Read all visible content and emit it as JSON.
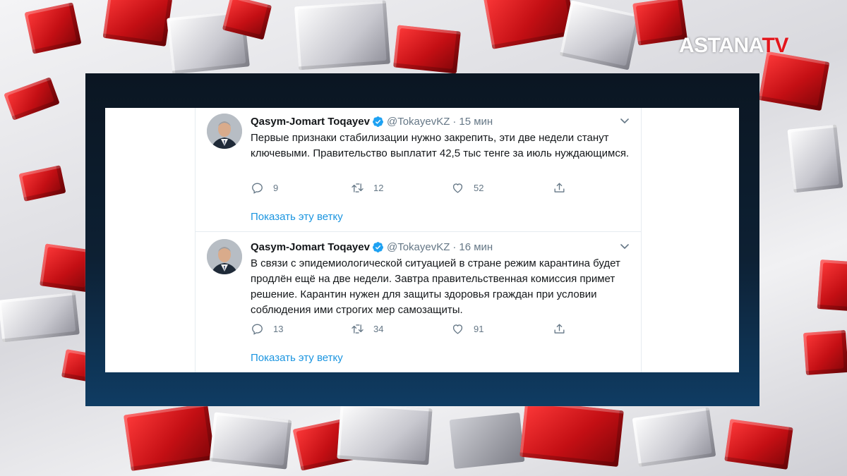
{
  "logo": {
    "main": "ASTANA",
    "accent": "TV"
  },
  "colors": {
    "link": "#1b95e0",
    "muted": "#657786",
    "text": "#14171a",
    "brand_red": "#e3151b"
  },
  "tweets": [
    {
      "name": "Qasym-Jomart Toqayev",
      "handle": "@TokayevKZ",
      "separator": "·",
      "time": "15 мин",
      "text": "Первые признаки стабилизации нужно закрепить, эти две недели станут ключевыми. Правительство выплатит 42,5 тыс тенге за июль нуждающимся.",
      "replies": "9",
      "retweets": "12",
      "likes": "52",
      "show_thread": "Показать эту ветку"
    },
    {
      "name": "Qasym-Jomart Toqayev",
      "handle": "@TokayevKZ",
      "separator": "·",
      "time": "16 мин",
      "text": "В связи с эпидемиологической ситуацией в стране режим карантина будет продлён ещё на две недели. Завтра правительственная комиссия примет решение. Карантин нужен для защиты здоровья граждан при условии соблюдения ими строгих мер самозащиты.",
      "replies": "13",
      "retweets": "34",
      "likes": "91",
      "show_thread": "Показать эту ветку"
    }
  ]
}
